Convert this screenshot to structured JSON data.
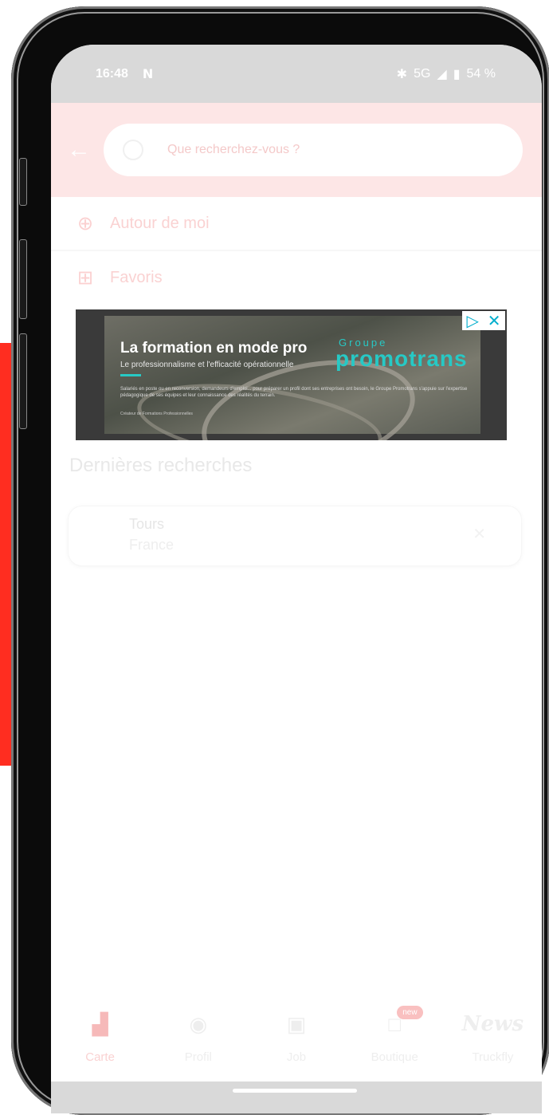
{
  "status_bar": {
    "time": "16:48",
    "notif_icon": "netflix-n-icon",
    "network": "5G",
    "battery": "54 %"
  },
  "search": {
    "placeholder": "Que recherchez-vous ?"
  },
  "menu": [
    {
      "label": "Autour de moi",
      "icon": "location-target-icon"
    },
    {
      "label": "Favoris",
      "icon": "bookmark-plus-icon"
    }
  ],
  "ad": {
    "title": "La formation en mode pro",
    "subtitle": "Le professionnalisme et l'efficacité opérationnelle",
    "body": "Salariés en poste ou en reconversion, demandeurs d'emploi... pour préparer un profil dont ses entreprises ont besoin, le Groupe Promotrans s'appuie sur l'expertise pédagogique de ses équipes et leur connaissance des réalités du terrain.",
    "footer": "Créateur de Formations Professionnelles",
    "brand_small": "Groupe",
    "brand": "promotrans"
  },
  "recent": {
    "title": "Dernières recherches",
    "items": [
      {
        "city": "Tours",
        "country": "France"
      }
    ]
  },
  "nav": {
    "items": [
      {
        "label": "Carte",
        "icon": "map-icon",
        "active": true
      },
      {
        "label": "Profil",
        "icon": "user-circle-icon",
        "active": false
      },
      {
        "label": "Job",
        "icon": "briefcase-icon",
        "active": false
      },
      {
        "label": "Boutique",
        "icon": "shopping-bag-icon",
        "active": false,
        "badge": "new"
      },
      {
        "label": "Truckfly",
        "icon": "news-icon",
        "active": false,
        "icon_text": "News"
      }
    ]
  },
  "colors": {
    "accent": "#fde6e6",
    "strip": "#ff2d20"
  }
}
